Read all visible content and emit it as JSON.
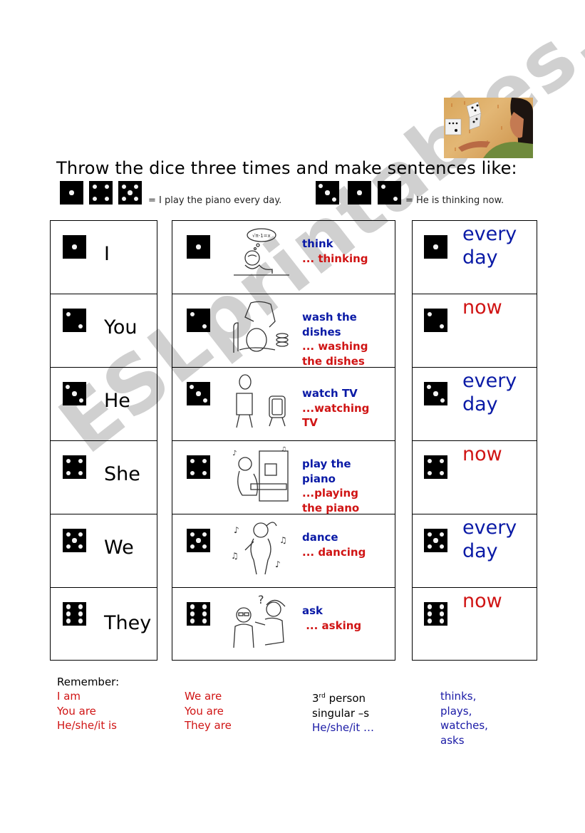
{
  "title": "Throw the dice three times and make sentences like:",
  "examples": [
    {
      "dice": [
        1,
        4,
        5
      ],
      "text": "= I play the piano every day."
    },
    {
      "dice": [
        3,
        1,
        2
      ],
      "text": "= He is thinking now."
    }
  ],
  "subjects": [
    {
      "die": 1,
      "label": "I"
    },
    {
      "die": 2,
      "label": "You"
    },
    {
      "die": 3,
      "label": "He"
    },
    {
      "die": 4,
      "label": "She"
    },
    {
      "die": 5,
      "label": "We"
    },
    {
      "die": 6,
      "label": "They"
    }
  ],
  "verbs": [
    {
      "die": 1,
      "image": "thinking-boy-illustration",
      "base": [
        "think"
      ],
      "ing": [
        "... thinking"
      ]
    },
    {
      "die": 2,
      "image": "washing-dishes-illustration",
      "base": [
        "wash the",
        "dishes"
      ],
      "ing": [
        "... washing",
        "the dishes"
      ]
    },
    {
      "die": 3,
      "image": "watching-tv-illustration",
      "base": [
        "watch TV"
      ],
      "ing": [
        "...watching",
        "TV"
      ]
    },
    {
      "die": 4,
      "image": "playing-piano-illustration",
      "base": [
        "play the",
        "piano"
      ],
      "ing": [
        "...playing",
        "the piano"
      ]
    },
    {
      "die": 5,
      "image": "dancing-man-illustration",
      "base": [
        "dance"
      ],
      "ing": [
        "... dancing"
      ]
    },
    {
      "die": 6,
      "image": "asking-question-illustration",
      "base": [
        "ask"
      ],
      "ing": [
        " ... asking"
      ]
    }
  ],
  "times": [
    {
      "die": 1,
      "lines": [
        "every",
        "day"
      ],
      "color": "blue"
    },
    {
      "die": 2,
      "lines": [
        "now"
      ],
      "color": "red"
    },
    {
      "die": 3,
      "lines": [
        "every",
        "day"
      ],
      "color": "blue"
    },
    {
      "die": 4,
      "lines": [
        "now"
      ],
      "color": "red"
    },
    {
      "die": 5,
      "lines": [
        "every",
        "day"
      ],
      "color": "blue"
    },
    {
      "die": 6,
      "lines": [
        "now"
      ],
      "color": "red"
    }
  ],
  "remember": {
    "heading": "Remember:",
    "singular": [
      "I am",
      "You are",
      "He/she/it is"
    ],
    "plural": [
      "We are",
      "You are",
      "They are"
    ],
    "third_person": {
      "ordinal_number": "3",
      "ordinal_suffix": "rd",
      "line1_rest": " person",
      "line2": "singular –s",
      "line3": "He/she/it …"
    },
    "examples": [
      "thinks,",
      "plays,",
      "watches,",
      "asks"
    ]
  },
  "watermark": "ESLprintables.com",
  "colors": {
    "blue": "#0a1aa6",
    "red": "#d01414"
  }
}
